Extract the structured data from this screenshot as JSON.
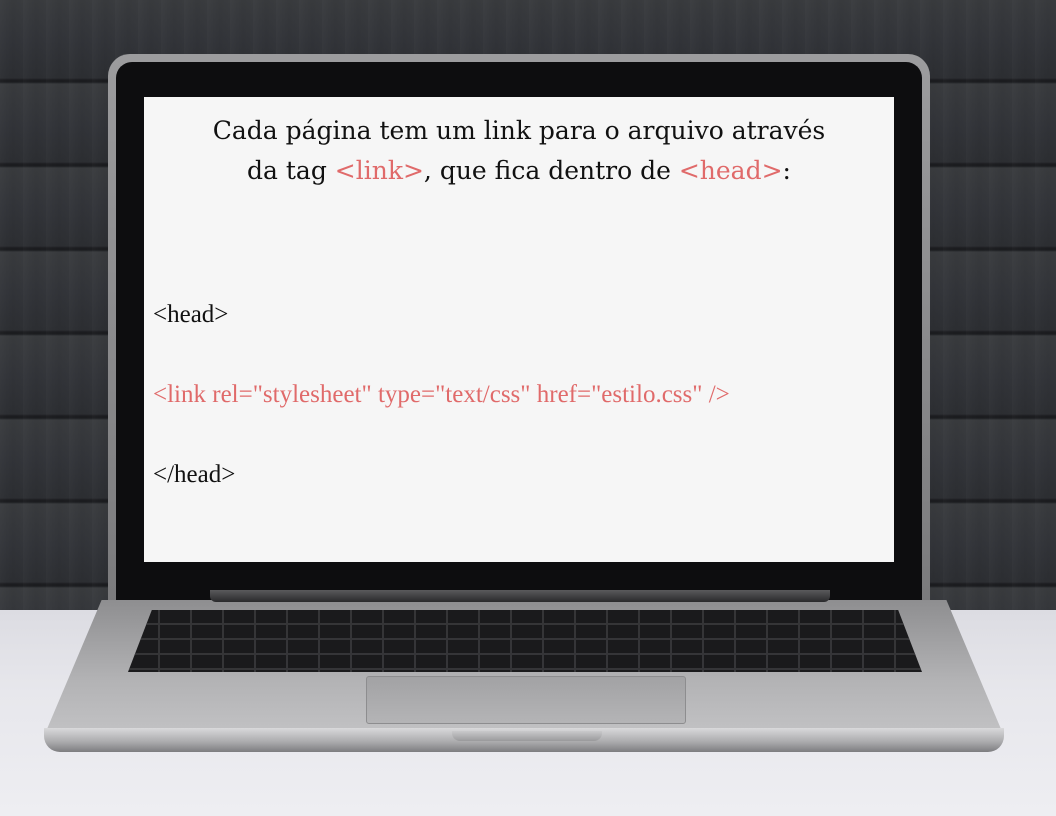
{
  "screen": {
    "intro_line1": "Cada página tem um link para o arquivo através",
    "intro_line2_before": "da tag ",
    "intro_tag_link": "<link>",
    "intro_line2_middle": ", que fica dentro de ",
    "intro_tag_head": "<head>",
    "intro_line2_end": ":",
    "code": {
      "open_head": "<head>",
      "link_line": "<link rel=\"stylesheet\" type=\"text/css\" href=\"estilo.css\" />",
      "close_head": "</head>"
    }
  },
  "colors": {
    "highlight": "#e06a6a",
    "text": "#111111",
    "screen_background": "#f6f6f6"
  }
}
